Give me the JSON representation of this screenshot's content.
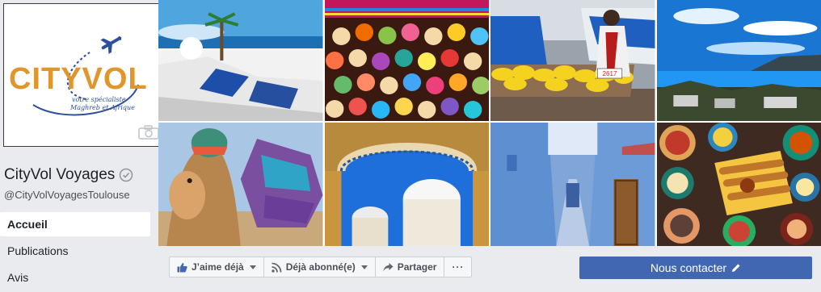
{
  "profile": {
    "logo": {
      "brand": "CITYVOL",
      "tagline_1": "votre spécialiste",
      "tagline_2": "Maghreb et Afrique"
    },
    "icons": {
      "camera": "camera-icon",
      "verified": "verified-badge-icon"
    },
    "name": "CityVol Voyages",
    "handle": "@CityVolVoyagesToulouse"
  },
  "nav": {
    "items": [
      {
        "label": "Accueil",
        "active": true
      },
      {
        "label": "Publications",
        "active": false
      },
      {
        "label": "Avis",
        "active": false
      }
    ]
  },
  "cover": {
    "tiles": [
      {
        "subject": "white-blue-village-seaside",
        "sign_text": ""
      },
      {
        "subject": "painted-sugar-skulls-market",
        "sign_text": ""
      },
      {
        "subject": "banana-cart-vendor",
        "sign_text": "2617"
      },
      {
        "subject": "coastal-bay-panorama",
        "sign_text": ""
      },
      {
        "subject": "camel-with-patterned-blanket",
        "sign_text": ""
      },
      {
        "subject": "mosque-domes-through-arch",
        "sign_text": ""
      },
      {
        "subject": "blue-alley-chefchaouen",
        "sign_text": ""
      },
      {
        "subject": "moroccan-food-spread",
        "sign_text": ""
      }
    ]
  },
  "actions": {
    "like_label": "J’aime déjà",
    "follow_label": "Déjà abonné(e)",
    "share_label": "Partager",
    "more_label": "···",
    "contact_label": "Nous contacter"
  },
  "colors": {
    "page_bg": "#e9ebee",
    "brand_orange": "#e0962a",
    "brand_blue": "#2c4f9e",
    "fb_blue": "#4267b2",
    "like_blue": "#4267b2"
  }
}
